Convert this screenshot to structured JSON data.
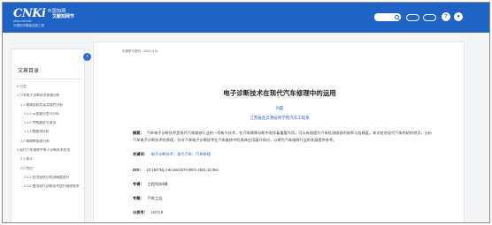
{
  "header": {
    "logo_mark": "CNKi",
    "logo_name": "中国知网",
    "logo_url": "www.cnki.net",
    "logo_tagline": "中国知识基础设施工程",
    "site_title": "文献知网节",
    "button_1": "",
    "button_2": "",
    "icon_1": "?"
  },
  "sidebar": {
    "title": "文章目录",
    "collapse_symbol": "‹",
    "toc": [
      "0 引言",
      "1 汽车电子诊断技术原理分析",
      "1.1 故障阻码判读实操性分析",
      "1.1.1 示波器与信号分析",
      "1.1.2 传感器信号测试",
      "1.1.3 数据流分析",
      "1.2 故障数据流分析",
      "2 现代汽车维修中电子诊断技术应用",
      "2.1 意义",
      "2.2 特点",
      "2.2.1 应用现状与检测精度提升",
      "2.2.2 使用现代诊断技术提升维修效率"
    ]
  },
  "main": {
    "breadcrumb": "内燃机与配件 . 2021 (13)",
    "title": "电子诊断技术在现代汽车修理中的运用",
    "author": "刘磊",
    "organization": "江苏省连云港技师学院汽车工程系",
    "abstract_label": "摘要：",
    "abstract_text": "汽车电子诊断技术是现代汽车维修行业的一项新兴技术，在汽车故障诊断中发挥着重要作用，可以有效提升汽车检测维修的效率与准确度。本文结合现代汽车的结构特点，分析汽车电子诊断技术的原理，针对汽车电子诊断技术在汽车维修中的具体应用展开探讨，以期为汽车维修行业的发展提供参考。",
    "keywords_label": "关键词：",
    "keywords": "电子诊断技术；现代汽车；汽车修理",
    "doi_label": "DOI：",
    "doi": "10.19475/j.cnki.issn1674-957x.2021.13.064",
    "section_label": "专辑：",
    "section": "工程科技Ⅱ辑",
    "topic_label": "专题：",
    "topic": "汽车工业",
    "class_label": "分类号：",
    "class_no": "U472.9"
  }
}
